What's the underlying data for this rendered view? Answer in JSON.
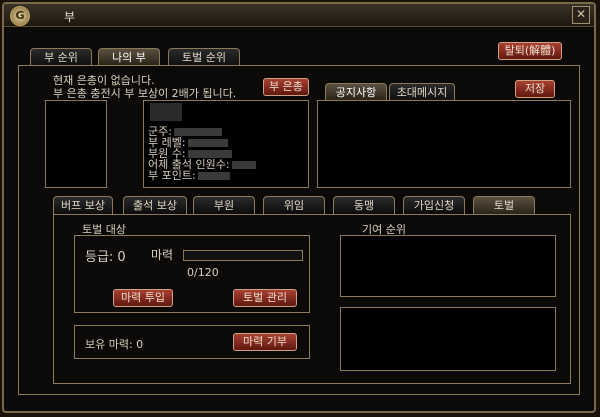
{
  "window": {
    "logo": "G",
    "title": "부",
    "close": "✕"
  },
  "top_tabs": [
    "부 순위",
    "나의 부",
    "토벌 순위"
  ],
  "leave_button": "탈퇴(解體)",
  "notice": {
    "line1": "현재 은총이 없습니다.",
    "line2": "부 은총 충전시 부 보상이 2배가 됩니다."
  },
  "grace_button": "부 은총",
  "info": {
    "lord": "군주:",
    "level": "부 레벨:",
    "members": "부원 수:",
    "yesterday": "어제 출석 인원수:",
    "points": "부 포인트:"
  },
  "msg_tabs": [
    "공지사항",
    "초대메시지"
  ],
  "save_button": "저장",
  "sub_tabs": [
    "버프 보상",
    "출석 보상",
    "부원",
    "위임",
    "동맹",
    "가입신청",
    "토벌"
  ],
  "subjugation": {
    "target_label": "토벌 대상",
    "grade": "등급: 0",
    "mana_label": "마력",
    "mana_value": "0/120",
    "mana_progress": 0.0,
    "mana_investment": "마력 투입",
    "subjugation_manage": "토벌 관리",
    "held_mana": "보유 마력: 0",
    "mana_donate": "마력 기부"
  },
  "contribution_title": "기여 순위"
}
